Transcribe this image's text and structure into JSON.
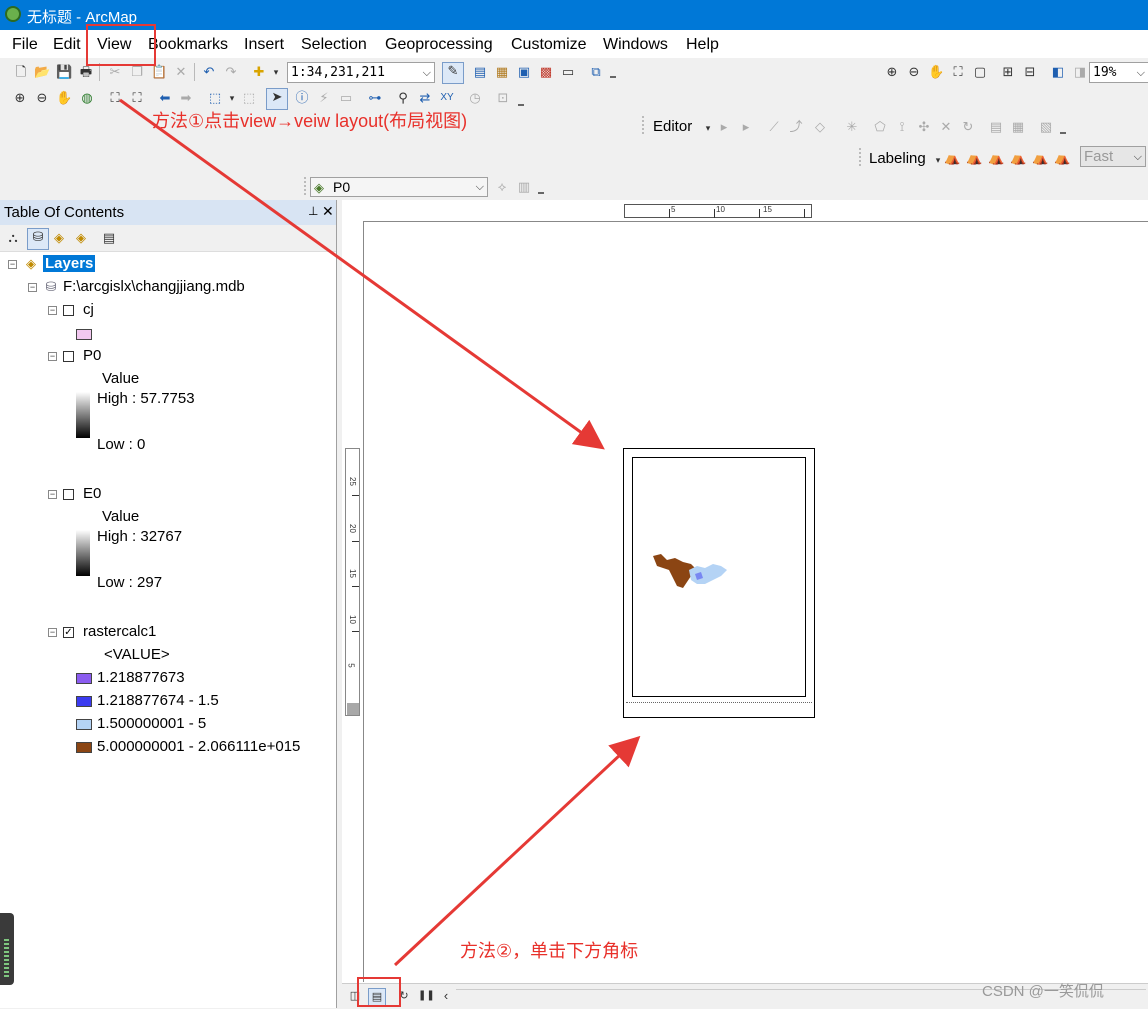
{
  "window": {
    "title": "无标题 - ArcMap"
  },
  "menu": [
    "File",
    "Edit",
    "View",
    "Bookmarks",
    "Insert",
    "Selection",
    "Geoprocessing",
    "Customize",
    "Windows",
    "Help"
  ],
  "toolbar": {
    "scale": "1:34,231,211",
    "zoom": "19%",
    "editor_label": "Editor",
    "labeling_label": "Labeling",
    "fast_label": "Fast",
    "layer_select": "P0"
  },
  "toc": {
    "title": "Table Of Contents",
    "layers_root": "Layers",
    "database": "F:\\arcgislx\\changjjiang.mdb",
    "layers": [
      {
        "name": "cj",
        "checked": false
      },
      {
        "name": "P0",
        "checked": false,
        "legend_title": "Value",
        "high": "High : 57.7753",
        "low": "Low : 0"
      },
      {
        "name": "E0",
        "checked": false,
        "legend_title": "Value",
        "high": "High : 32767",
        "low": "Low : 297"
      },
      {
        "name": "rastercalc1",
        "checked": true,
        "legend_title": "<VALUE>",
        "classes": [
          {
            "label": "1.218877673",
            "color": "#8b5cf0"
          },
          {
            "label": "1.218877674 - 1.5",
            "color": "#3b3bf0"
          },
          {
            "label": "1.500000001 - 5",
            "color": "#b4d3f5"
          },
          {
            "label": "5.000000001 - 2.066111e+015",
            "color": "#8b4513"
          }
        ]
      }
    ]
  },
  "ruler": {
    "top": [
      "5",
      "10",
      "15"
    ],
    "left": [
      "25",
      "20",
      "15",
      "10",
      "5"
    ]
  },
  "annotations": {
    "method1": "方法①点击view→veiw layout(布局视图)",
    "method2": "方法②，单击下方角标"
  },
  "colors": {
    "titlebar": "#0078d7",
    "annotation": "#e8302a",
    "map_brown": "#8b4513",
    "map_light_blue": "#b4d3f5"
  },
  "watermark": "CSDN @一笑侃侃"
}
